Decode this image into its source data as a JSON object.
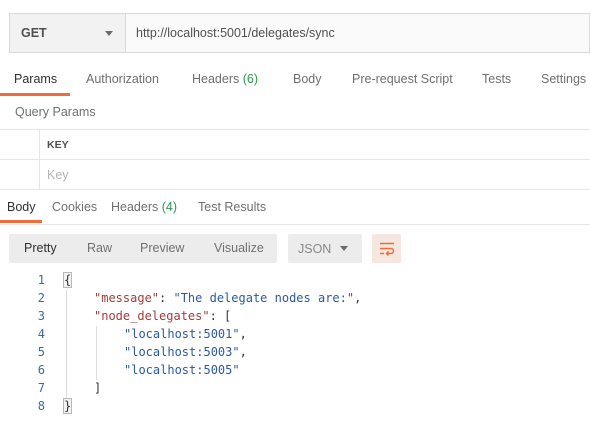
{
  "request": {
    "method": "GET",
    "url": "http://localhost:5001/delegates/sync"
  },
  "request_tabs": [
    {
      "label": "Params",
      "count": ""
    },
    {
      "label": "Authorization",
      "count": ""
    },
    {
      "label": "Headers",
      "count": "(6)"
    },
    {
      "label": "Body",
      "count": ""
    },
    {
      "label": "Pre-request Script",
      "count": ""
    },
    {
      "label": "Tests",
      "count": ""
    },
    {
      "label": "Settings",
      "count": ""
    }
  ],
  "query_params": {
    "title": "Query Params",
    "key_header": "KEY",
    "key_placeholder": "Key"
  },
  "response_tabs": [
    {
      "label": "Body",
      "count": ""
    },
    {
      "label": "Cookies",
      "count": ""
    },
    {
      "label": "Headers",
      "count": "(4)"
    },
    {
      "label": "Test Results",
      "count": ""
    }
  ],
  "view_options": [
    "Pretty",
    "Raw",
    "Preview",
    "Visualize"
  ],
  "format": "JSON",
  "response_body": {
    "line_numbers": [
      "1",
      "2",
      "3",
      "4",
      "5",
      "6",
      "7",
      "8"
    ],
    "open_brace": "{",
    "close_brace": "}",
    "message_key": "\"message\"",
    "message_value": "\"The delegate nodes are:\"",
    "node_delegates_key": "\"node_delegates\"",
    "open_bracket": "[",
    "close_bracket": "]",
    "delegates": [
      "\"localhost:5001\"",
      "\"localhost:5003\"",
      "\"localhost:5005\""
    ],
    "colon": ": ",
    "comma": ","
  },
  "colors": {
    "accent": "#f26b3a",
    "count_green": "#2e9a4d",
    "json_key": "#a33b3b",
    "json_string": "#2a5aa5"
  },
  "icons": [
    "chevron-down-icon",
    "wrap-lines-icon"
  ]
}
